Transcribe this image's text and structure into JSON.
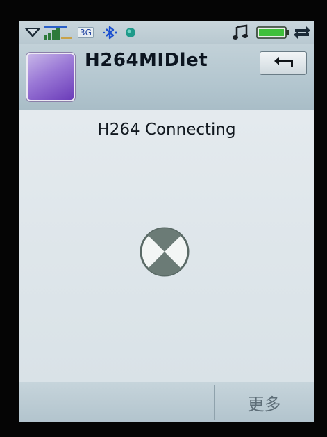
{
  "status_bar": {
    "network_label": "3G",
    "icons": [
      "signal-arrow-icon",
      "signal-strength-icon",
      "bluetooth-icon",
      "internet-globe-icon",
      "music-note-icon",
      "battery-icon",
      "sync-icon"
    ]
  },
  "title_bar": {
    "app_name": "H264MIDlet",
    "back_button_icon": "back-arrow-icon"
  },
  "content": {
    "status_text": "H264 Connecting",
    "spinner_icon": "loading-spinner-icon"
  },
  "soft_keys": {
    "left_label": "",
    "right_label": "更多"
  },
  "colors": {
    "screen_bg": "#dfe6ea",
    "bar_bg": "#b8c8d0",
    "app_icon_purple": "#6b3cb9",
    "spinner_gray": "#6b7b76",
    "bluetooth_blue": "#1a4fd0",
    "globe_teal": "#1f9a8a",
    "battery_green": "#3fbf3a"
  }
}
